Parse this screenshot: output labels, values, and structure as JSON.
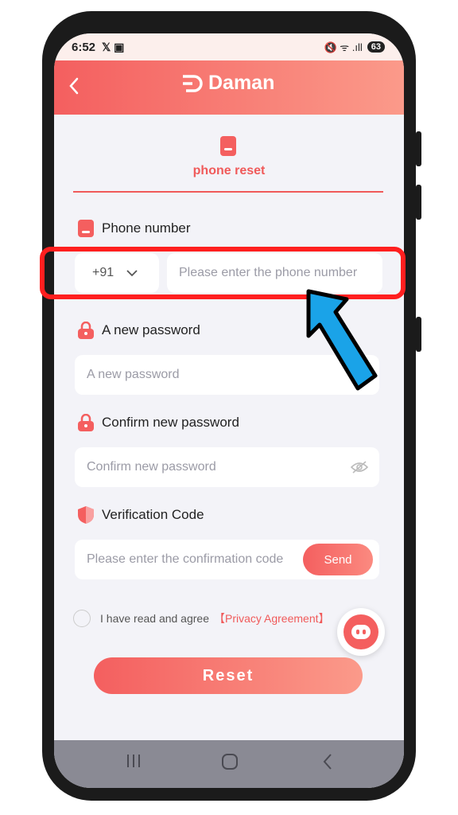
{
  "status_bar": {
    "time": "6:52",
    "left_icons": "𝕏 ▣",
    "right_icons": "🔇 ᯤ .ıll",
    "battery": "63"
  },
  "header": {
    "back_icon": "chevron-left-icon",
    "app_name": "Daman"
  },
  "tab": {
    "label": "phone reset"
  },
  "phone": {
    "label": "Phone number",
    "country_code": "+91",
    "placeholder": "Please enter the phone number"
  },
  "new_password": {
    "label": "A new password",
    "placeholder": "A new password"
  },
  "confirm_password": {
    "label": "Confirm new password",
    "placeholder": "Confirm new password"
  },
  "verification": {
    "label": "Verification Code",
    "placeholder": "Please enter the confirmation code",
    "send_label": "Send"
  },
  "agreement": {
    "text": "I have read and agree",
    "link": "【Privacy Agreement】"
  },
  "reset_label": "Reset",
  "colors": {
    "accent": "#f45f5f",
    "highlight": "#ff1f1f",
    "arrow": "#1aa3e8"
  }
}
